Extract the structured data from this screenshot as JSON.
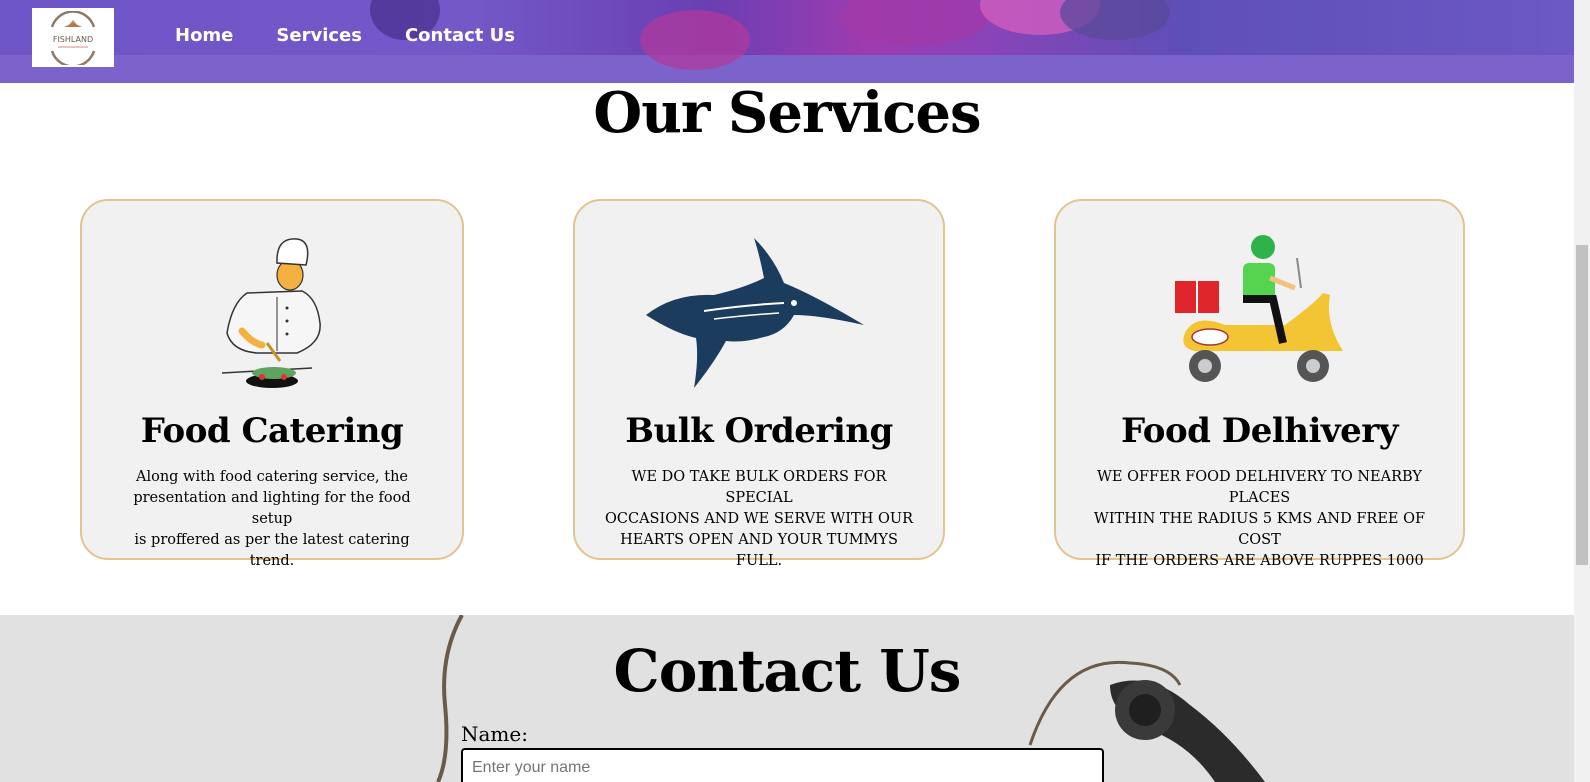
{
  "nav": {
    "logo_text": "FISHLAND",
    "items": [
      "Home",
      "Services",
      "Contact Us"
    ]
  },
  "services": {
    "title": "Our Services",
    "cards": [
      {
        "title": "Food Catering",
        "icon": "chef-cooking-icon",
        "lines": [
          "Along with food catering service, the",
          "presentation and lighting for the food setup",
          "is proffered as per the latest catering trend."
        ]
      },
      {
        "title": "Bulk Ordering",
        "icon": "marlin-fish-icon",
        "lines": [
          "WE DO TAKE BULK ORDERS FOR SPECIAL",
          "OCCASIONS AND WE SERVE WITH OUR",
          "HEARTS OPEN AND YOUR TUMMYS FULL."
        ]
      },
      {
        "title": "Food Delhivery",
        "icon": "delivery-scooter-icon",
        "lines": [
          "WE OFFER FOOD DELHIVERY TO NEARBY PLACES",
          "WITHIN THE RADIUS 5 KMS AND FREE OF COST",
          "IF THE ORDERS ARE ABOVE RUPPES 1000"
        ]
      }
    ]
  },
  "contact": {
    "title": "Contact Us",
    "name_label": "Name:",
    "name_placeholder": "Enter your name"
  },
  "colors": {
    "header": "#7c63cc",
    "card_border": "#e3c48f",
    "card_bg": "#f1f1f1",
    "contact_bg": "#e1e1e1"
  }
}
